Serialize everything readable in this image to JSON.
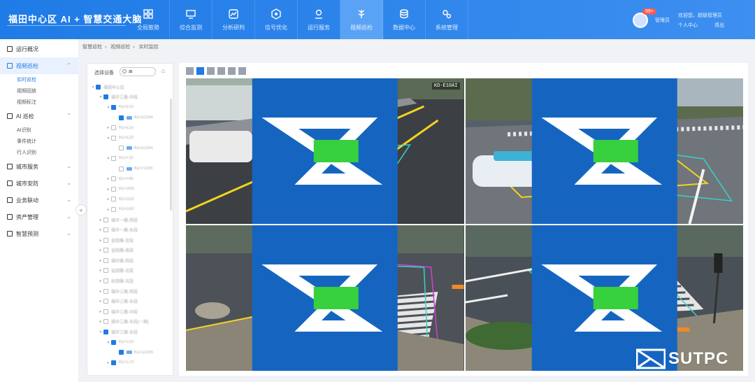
{
  "app": {
    "title": "福田中心区 AI + 智慧交通大脑"
  },
  "nav": [
    {
      "label": "全局態勢",
      "icon": "dashboard-icon"
    },
    {
      "label": "综合监测",
      "icon": "monitor-icon"
    },
    {
      "label": "分析研判",
      "icon": "analysis-icon"
    },
    {
      "label": "信号优化",
      "icon": "signal-icon"
    },
    {
      "label": "运行服务",
      "icon": "location-icon"
    },
    {
      "label": "视频巡检",
      "icon": "video-tree-icon"
    },
    {
      "label": "数据中心",
      "icon": "database-icon"
    },
    {
      "label": "系统管理",
      "icon": "settings-icon"
    }
  ],
  "user": {
    "badge": "99+",
    "role": "管理员",
    "welcome": "欢迎您，超级管理员",
    "center_link": "个人中心",
    "logout_link": "退出"
  },
  "sidebar": {
    "items": [
      {
        "label": "运行概况",
        "icon": "overview-icon"
      },
      {
        "label": "视频巡检",
        "icon": "video-icon",
        "expanded": true,
        "sub": [
          "实时巡检",
          "视频回放",
          "视频标注"
        ]
      },
      {
        "label": "AI 巡检",
        "icon": "ai-icon",
        "expanded": true,
        "sub": [
          "AI识别",
          "事件统计",
          "行人识别"
        ]
      },
      {
        "label": "城市服务",
        "icon": "city-icon"
      },
      {
        "label": "城市安防",
        "icon": "security-icon"
      },
      {
        "label": "业务联动",
        "icon": "link-icon"
      },
      {
        "label": "资产管理",
        "icon": "asset-icon"
      },
      {
        "label": "智慧预测",
        "icon": "predict-icon"
      }
    ]
  },
  "breadcrumb": [
    "智慧巡检",
    "视频巡检",
    "实时监控"
  ],
  "tree_panel": {
    "label": "选择设备",
    "search_value": "ai",
    "nodes": [
      {
        "level": 0,
        "label": "福田中心区",
        "checked": true,
        "toggle": "▾"
      },
      {
        "level": 1,
        "label": "福华三路-中段",
        "checked": true,
        "toggle": "▾"
      },
      {
        "level": 2,
        "label": "KD-E10",
        "checked": true,
        "toggle": "▾"
      },
      {
        "level": 3,
        "label": "KD-E10AI",
        "checked": true,
        "camera": true
      },
      {
        "level": 2,
        "label": "KD-E15",
        "checked": false,
        "toggle": "▸"
      },
      {
        "level": 2,
        "label": "KD-E20",
        "checked": false,
        "toggle": "▾"
      },
      {
        "level": 3,
        "label": "KD-E20AI",
        "checked": false,
        "camera": true
      },
      {
        "level": 2,
        "label": "KD-F10",
        "checked": false,
        "toggle": "▾"
      },
      {
        "level": 3,
        "label": "KD-F10AI",
        "checked": false,
        "camera": true
      },
      {
        "level": 2,
        "label": "KD-F40",
        "checked": false,
        "toggle": "▸"
      },
      {
        "level": 2,
        "label": "KD-G05",
        "checked": false,
        "toggle": "▸"
      },
      {
        "level": 2,
        "label": "KD-G20",
        "checked": false,
        "toggle": "▸"
      },
      {
        "level": 2,
        "label": "KD-G30",
        "checked": false,
        "toggle": "▸"
      },
      {
        "level": 1,
        "label": "福华一路-西段",
        "checked": false,
        "toggle": "▸"
      },
      {
        "level": 1,
        "label": "福华一路-东段",
        "checked": false,
        "toggle": "▸"
      },
      {
        "level": 1,
        "label": "金田路-北段",
        "checked": false,
        "toggle": "▸"
      },
      {
        "level": 1,
        "label": "金田路-南段",
        "checked": false,
        "toggle": "▸"
      },
      {
        "level": 1,
        "label": "福中路-西段",
        "checked": false,
        "toggle": "▸"
      },
      {
        "level": 1,
        "label": "益田路-北段",
        "checked": false,
        "toggle": "▸"
      },
      {
        "level": 1,
        "label": "民田路-北段",
        "checked": false,
        "toggle": "▸"
      },
      {
        "level": 1,
        "label": "福中三路-西段",
        "checked": false,
        "toggle": "▸"
      },
      {
        "level": 1,
        "label": "福中三路-东段",
        "checked": false,
        "toggle": "▸"
      },
      {
        "level": 1,
        "label": "福中三路-中段",
        "checked": false,
        "toggle": "▸"
      },
      {
        "level": 1,
        "label": "福中三路-东段(一期)",
        "checked": false,
        "toggle": "▸"
      },
      {
        "level": 1,
        "label": "福华三路-东段",
        "checked": true,
        "toggle": "▾"
      },
      {
        "level": 2,
        "label": "KD-C20",
        "checked": true,
        "toggle": "▾"
      },
      {
        "level": 3,
        "label": "KD-C20AI",
        "checked": true,
        "camera": true
      },
      {
        "level": 2,
        "label": "KD-C70",
        "checked": true,
        "toggle": "▸"
      }
    ]
  },
  "video": {
    "layout_options": [
      "1x1",
      "2x2",
      "1+5",
      "3x3",
      "4x4",
      "5x5"
    ],
    "active_layout": "2x2",
    "tiles": [
      {
        "id": "KD-E10AI",
        "scene": "street"
      },
      {
        "id": "",
        "scene": "taxi"
      },
      {
        "id": "",
        "scene": "crosswalk-left"
      },
      {
        "id": "",
        "scene": "crosswalk-right"
      }
    ]
  },
  "watermark": {
    "text": "SUTPC"
  },
  "colors": {
    "primary": "#1f7be6",
    "zone_cyan": "#3ad0c8",
    "zone_yellow": "#f2d320",
    "zone_magenta": "#d33fd6"
  }
}
